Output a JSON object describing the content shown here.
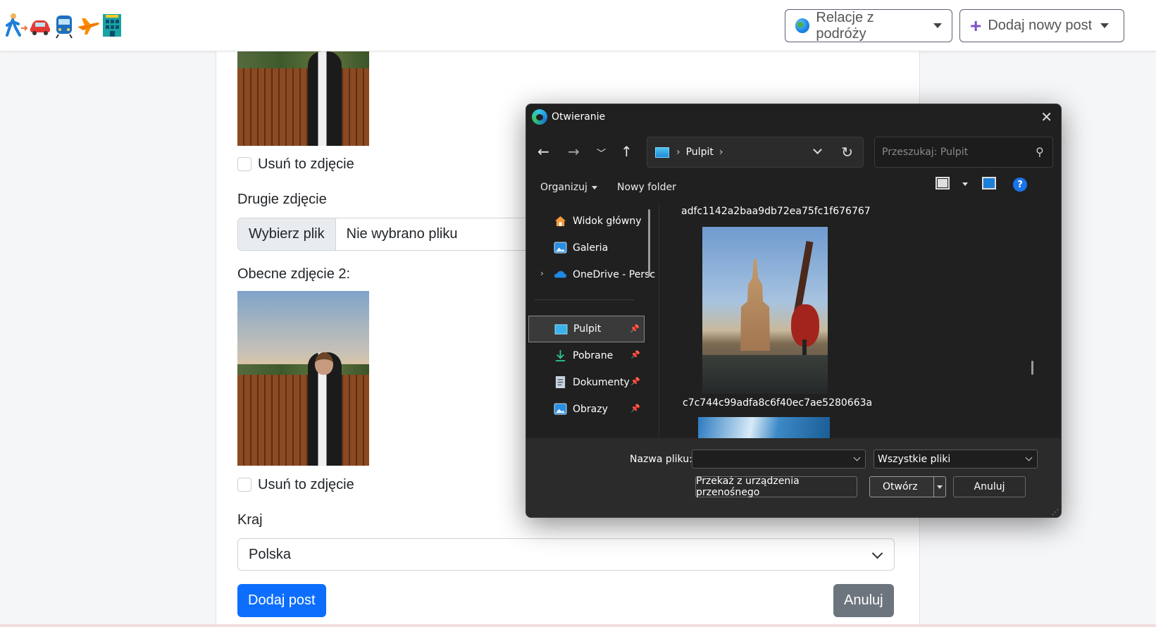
{
  "navbar": {
    "logo_icons": [
      "walking-person-icon",
      "car-icon",
      "train-icon",
      "airplane-icon",
      "hotel-icon"
    ],
    "relations_dropdown": "Relacje z podróży",
    "add_post_dropdown": "Dodaj nowy post"
  },
  "form": {
    "remove_photo_1": "Usuń to zdjęcie",
    "second_photo_label": "Drugie zdjęcie",
    "file_button": "Wybierz plik",
    "file_status": "Nie wybrano pliku",
    "current_photo_2_label": "Obecne zdjęcie 2:",
    "remove_photo_2": "Usuń to zdjęcie",
    "country_label": "Kraj",
    "country_value": "Polska",
    "submit_button": "Dodaj post",
    "cancel_button": "Anuluj"
  },
  "dialog": {
    "title": "Otwieranie",
    "breadcrumb": "Pulpit",
    "search_placeholder": "Przeszukaj: Pulpit",
    "toolbar": {
      "organize": "Organizuj",
      "new_folder": "Nowy folder"
    },
    "sidebar": [
      {
        "label": "Widok główny",
        "icon": "home-icon",
        "pinned": false
      },
      {
        "label": "Galeria",
        "icon": "gallery-icon",
        "pinned": false
      },
      {
        "label": "OneDrive - Persc",
        "icon": "onedrive-icon",
        "pinned": false
      },
      {
        "label": "Pulpit",
        "icon": "desktop-icon",
        "pinned": true,
        "active": true
      },
      {
        "label": "Pobrane",
        "icon": "download-icon",
        "pinned": true
      },
      {
        "label": "Dokumenty",
        "icon": "documents-icon",
        "pinned": true
      },
      {
        "label": "Obrazy",
        "icon": "pictures-icon",
        "pinned": true
      }
    ],
    "files": [
      {
        "name": "adfc1142a2baa9db72ea75fc1f676767"
      },
      {
        "name": "c7c744c99adfa8c6f40ec7ae5280663a"
      }
    ],
    "filename_label": "Nazwa pliku:",
    "filename_value": "",
    "filter_value": "Wszystkie pliki",
    "portable_button": "Przekaż z urządzenia przenośnego",
    "open_button": "Otwórz",
    "cancel_button": "Anuluj"
  },
  "colors": {
    "primary": "#0d6efd",
    "secondary": "#6c757d",
    "dialog_bg": "#202020",
    "dialog_footer": "#2b2b2b"
  }
}
